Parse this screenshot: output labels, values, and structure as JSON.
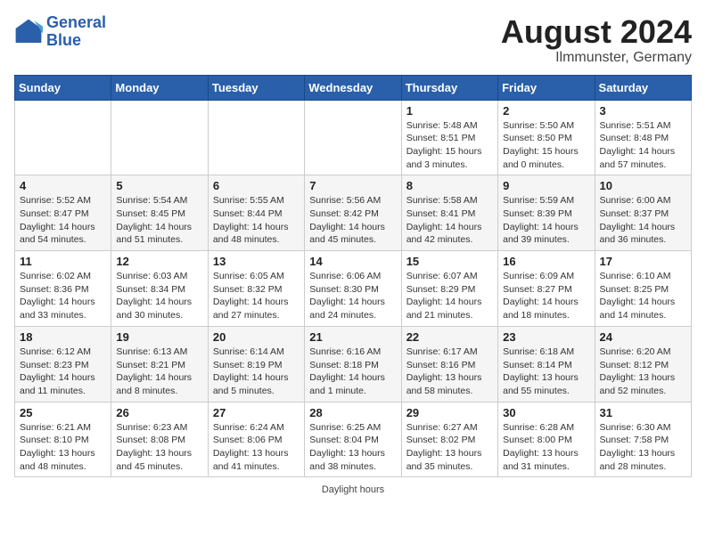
{
  "header": {
    "logo_line1": "General",
    "logo_line2": "Blue",
    "month_title": "August 2024",
    "location": "Ilmmunster, Germany"
  },
  "footer": {
    "label": "Daylight hours"
  },
  "days_of_week": [
    "Sunday",
    "Monday",
    "Tuesday",
    "Wednesday",
    "Thursday",
    "Friday",
    "Saturday"
  ],
  "weeks": [
    [
      {
        "num": "",
        "info": ""
      },
      {
        "num": "",
        "info": ""
      },
      {
        "num": "",
        "info": ""
      },
      {
        "num": "",
        "info": ""
      },
      {
        "num": "1",
        "info": "Sunrise: 5:48 AM\nSunset: 8:51 PM\nDaylight: 15 hours\nand 3 minutes."
      },
      {
        "num": "2",
        "info": "Sunrise: 5:50 AM\nSunset: 8:50 PM\nDaylight: 15 hours\nand 0 minutes."
      },
      {
        "num": "3",
        "info": "Sunrise: 5:51 AM\nSunset: 8:48 PM\nDaylight: 14 hours\nand 57 minutes."
      }
    ],
    [
      {
        "num": "4",
        "info": "Sunrise: 5:52 AM\nSunset: 8:47 PM\nDaylight: 14 hours\nand 54 minutes."
      },
      {
        "num": "5",
        "info": "Sunrise: 5:54 AM\nSunset: 8:45 PM\nDaylight: 14 hours\nand 51 minutes."
      },
      {
        "num": "6",
        "info": "Sunrise: 5:55 AM\nSunset: 8:44 PM\nDaylight: 14 hours\nand 48 minutes."
      },
      {
        "num": "7",
        "info": "Sunrise: 5:56 AM\nSunset: 8:42 PM\nDaylight: 14 hours\nand 45 minutes."
      },
      {
        "num": "8",
        "info": "Sunrise: 5:58 AM\nSunset: 8:41 PM\nDaylight: 14 hours\nand 42 minutes."
      },
      {
        "num": "9",
        "info": "Sunrise: 5:59 AM\nSunset: 8:39 PM\nDaylight: 14 hours\nand 39 minutes."
      },
      {
        "num": "10",
        "info": "Sunrise: 6:00 AM\nSunset: 8:37 PM\nDaylight: 14 hours\nand 36 minutes."
      }
    ],
    [
      {
        "num": "11",
        "info": "Sunrise: 6:02 AM\nSunset: 8:36 PM\nDaylight: 14 hours\nand 33 minutes."
      },
      {
        "num": "12",
        "info": "Sunrise: 6:03 AM\nSunset: 8:34 PM\nDaylight: 14 hours\nand 30 minutes."
      },
      {
        "num": "13",
        "info": "Sunrise: 6:05 AM\nSunset: 8:32 PM\nDaylight: 14 hours\nand 27 minutes."
      },
      {
        "num": "14",
        "info": "Sunrise: 6:06 AM\nSunset: 8:30 PM\nDaylight: 14 hours\nand 24 minutes."
      },
      {
        "num": "15",
        "info": "Sunrise: 6:07 AM\nSunset: 8:29 PM\nDaylight: 14 hours\nand 21 minutes."
      },
      {
        "num": "16",
        "info": "Sunrise: 6:09 AM\nSunset: 8:27 PM\nDaylight: 14 hours\nand 18 minutes."
      },
      {
        "num": "17",
        "info": "Sunrise: 6:10 AM\nSunset: 8:25 PM\nDaylight: 14 hours\nand 14 minutes."
      }
    ],
    [
      {
        "num": "18",
        "info": "Sunrise: 6:12 AM\nSunset: 8:23 PM\nDaylight: 14 hours\nand 11 minutes."
      },
      {
        "num": "19",
        "info": "Sunrise: 6:13 AM\nSunset: 8:21 PM\nDaylight: 14 hours\nand 8 minutes."
      },
      {
        "num": "20",
        "info": "Sunrise: 6:14 AM\nSunset: 8:19 PM\nDaylight: 14 hours\nand 5 minutes."
      },
      {
        "num": "21",
        "info": "Sunrise: 6:16 AM\nSunset: 8:18 PM\nDaylight: 14 hours\nand 1 minute."
      },
      {
        "num": "22",
        "info": "Sunrise: 6:17 AM\nSunset: 8:16 PM\nDaylight: 13 hours\nand 58 minutes."
      },
      {
        "num": "23",
        "info": "Sunrise: 6:18 AM\nSunset: 8:14 PM\nDaylight: 13 hours\nand 55 minutes."
      },
      {
        "num": "24",
        "info": "Sunrise: 6:20 AM\nSunset: 8:12 PM\nDaylight: 13 hours\nand 52 minutes."
      }
    ],
    [
      {
        "num": "25",
        "info": "Sunrise: 6:21 AM\nSunset: 8:10 PM\nDaylight: 13 hours\nand 48 minutes."
      },
      {
        "num": "26",
        "info": "Sunrise: 6:23 AM\nSunset: 8:08 PM\nDaylight: 13 hours\nand 45 minutes."
      },
      {
        "num": "27",
        "info": "Sunrise: 6:24 AM\nSunset: 8:06 PM\nDaylight: 13 hours\nand 41 minutes."
      },
      {
        "num": "28",
        "info": "Sunrise: 6:25 AM\nSunset: 8:04 PM\nDaylight: 13 hours\nand 38 minutes."
      },
      {
        "num": "29",
        "info": "Sunrise: 6:27 AM\nSunset: 8:02 PM\nDaylight: 13 hours\nand 35 minutes."
      },
      {
        "num": "30",
        "info": "Sunrise: 6:28 AM\nSunset: 8:00 PM\nDaylight: 13 hours\nand 31 minutes."
      },
      {
        "num": "31",
        "info": "Sunrise: 6:30 AM\nSunset: 7:58 PM\nDaylight: 13 hours\nand 28 minutes."
      }
    ]
  ]
}
